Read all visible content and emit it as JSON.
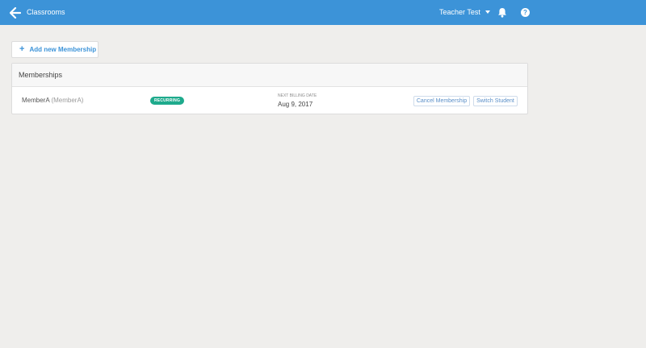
{
  "topbar": {
    "title": "Classrooms",
    "user_name": "Teacher Test",
    "help_glyph": "?",
    "icons": {
      "back": "arrow-left-icon",
      "menu": "caret-down-icon",
      "notifications": "bell-icon",
      "help": "help-icon"
    }
  },
  "add_button": {
    "icon_glyph": "+",
    "label": "Add new Membership"
  },
  "memberships": {
    "title": "Memberships",
    "rows": [
      {
        "name": "MemberA",
        "username": "(MemberA)",
        "status": "RECURRING",
        "billing_label": "NEXT BILLING DATE",
        "billing_date": "Aug 9, 2017",
        "cancel_label": "Cancel Membership",
        "switch_label": "Switch Student"
      }
    ]
  },
  "colors": {
    "topbar": "#3c93d8",
    "accent": "#3c93d8",
    "badge": "#1eaa8c",
    "background": "#efeeec"
  }
}
